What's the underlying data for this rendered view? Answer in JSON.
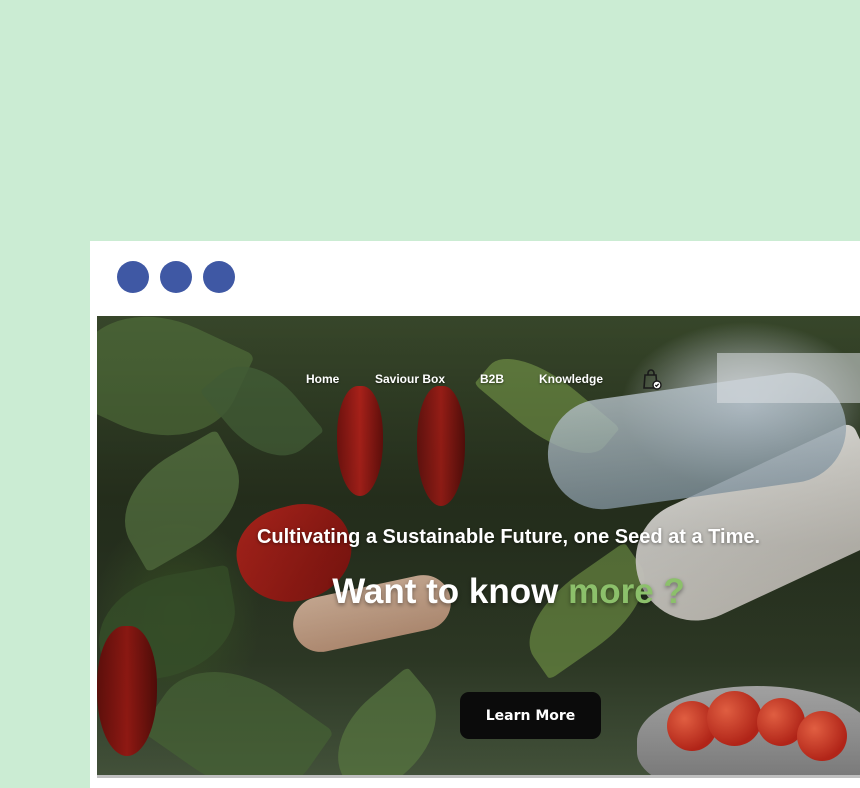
{
  "nav": {
    "items": [
      {
        "label": "Home"
      },
      {
        "label": "Saviour Box"
      },
      {
        "label": "B2B"
      },
      {
        "label": "Knowledge"
      }
    ],
    "cart_icon": "shopping-bag-icon"
  },
  "hero": {
    "tagline": "Cultivating a Sustainable Future, one Seed at a Time.",
    "headline_main": "Want to know ",
    "headline_accent": "more ?",
    "cta_label": "Learn More"
  },
  "colors": {
    "page_background": "#cbecd3",
    "window_dot": "#3f58a4",
    "accent_green": "#8cc06b",
    "button_background": "#0b0b0b"
  }
}
